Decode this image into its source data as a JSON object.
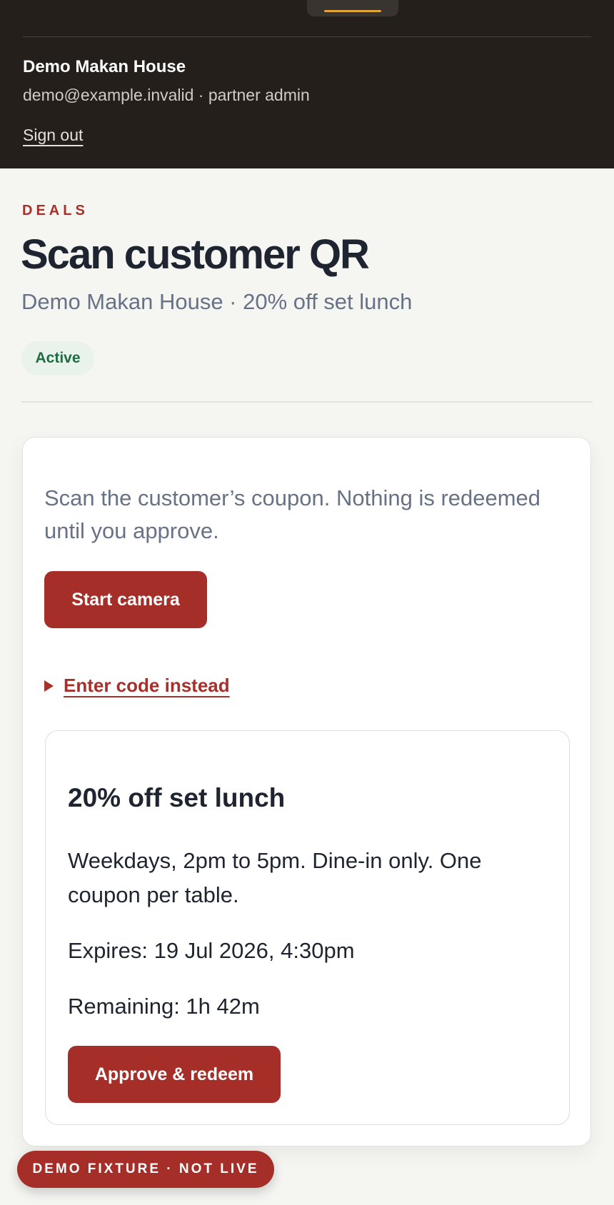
{
  "header": {
    "business_name": "Demo Makan House",
    "user_meta": "demo@example.invalid · partner admin",
    "sign_out_label": "Sign out",
    "accent_color": "#e0a43a",
    "background_color": "#241f1b"
  },
  "page": {
    "eyebrow": "DEALS",
    "title": "Scan customer QR",
    "subtitle": "Demo Makan House · 20% off set lunch",
    "status_badge": "Active",
    "status_color": "#1e6c44"
  },
  "scanner": {
    "instructions": "Scan the customer’s coupon. Nothing is redeemed until you approve.",
    "start_camera_label": "Start camera",
    "enter_code_label": "Enter code instead",
    "enter_code_expanded": false
  },
  "deal": {
    "title": "20% off set lunch",
    "description": "Weekdays, 2pm to 5pm. Dine-in only. One coupon per table.",
    "expires": "Expires: 19 Jul 2026, 4:30pm",
    "remaining": "Remaining: 1h 42m",
    "approve_label": "Approve & redeem"
  },
  "demo_banner": "DEMO FIXTURE · NOT LIVE",
  "colors": {
    "primary": "#a52f28",
    "muted_text": "#687287",
    "page_background": "#f5f5f2"
  }
}
